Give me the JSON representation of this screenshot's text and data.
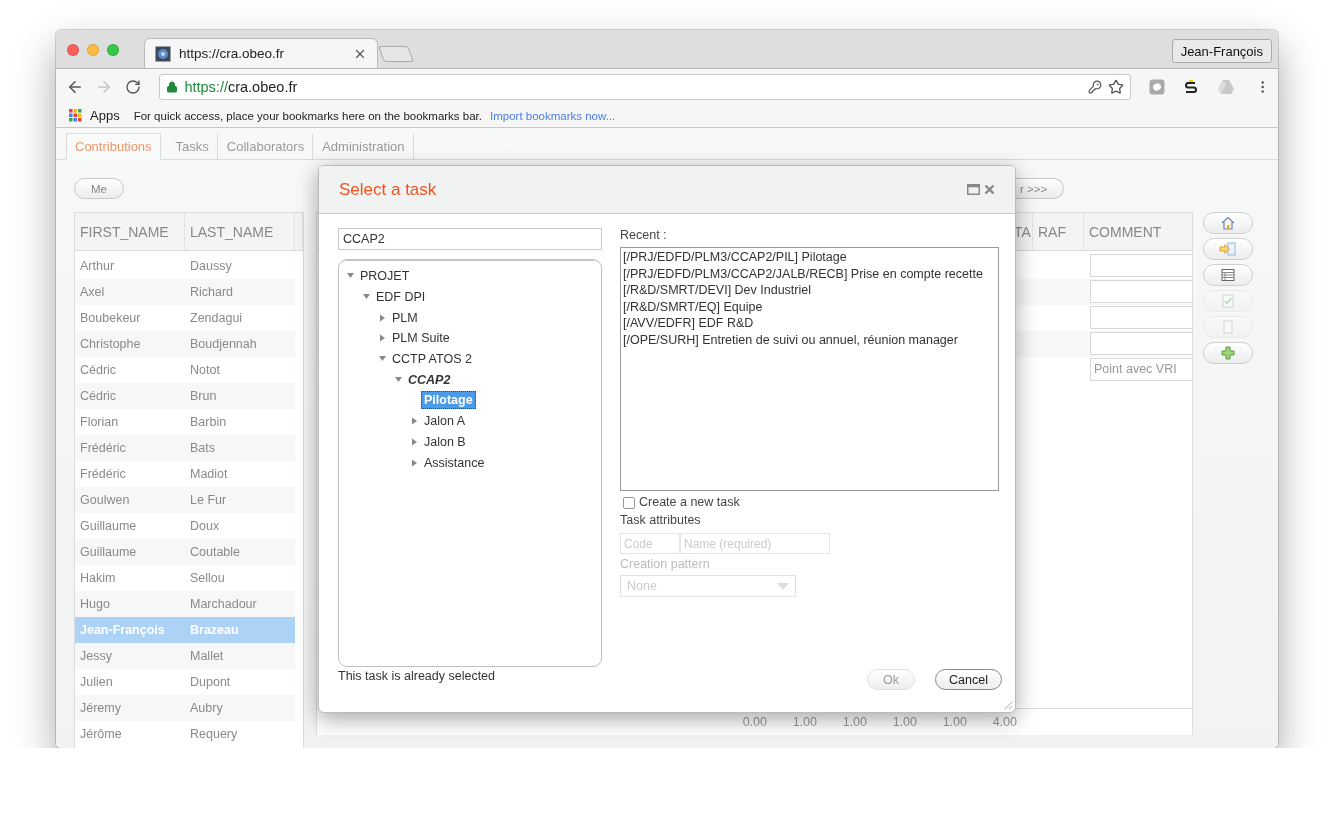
{
  "browser": {
    "tab_title": "https://cra.obeo.fr",
    "profile": "Jean-François",
    "url_scheme": "https://",
    "url_host": "cra.obeo.fr",
    "apps": "Apps",
    "bookmarks_hint": "For quick access, place your bookmarks here on the bookmarks bar.",
    "bookmarks_link": "Import bookmarks now..."
  },
  "app_tabs": [
    {
      "label": "Contributions",
      "selected": true
    },
    {
      "label": "Tasks",
      "selected": false
    },
    {
      "label": "Collaborators",
      "selected": false
    },
    {
      "label": "Administration",
      "selected": false
    }
  ],
  "me_button": "Me",
  "people_table": {
    "columns": [
      "FIRST_NAME",
      "LAST_NAME"
    ],
    "rows": [
      {
        "first": "Arthur",
        "last": "Daussy",
        "selected": false
      },
      {
        "first": "Axel",
        "last": "Richard",
        "selected": false
      },
      {
        "first": "Boubekeur",
        "last": "Zendagui",
        "selected": false
      },
      {
        "first": "Christophe",
        "last": "Boudjennah",
        "selected": false
      },
      {
        "first": "Cédric",
        "last": "Notot",
        "selected": false
      },
      {
        "first": "Cédric",
        "last": "Brun",
        "selected": false
      },
      {
        "first": "Florian",
        "last": "Barbin",
        "selected": false
      },
      {
        "first": "Frédéric",
        "last": "Bats",
        "selected": false
      },
      {
        "first": "Frédéric",
        "last": "Madiot",
        "selected": false
      },
      {
        "first": "Goulwen",
        "last": "Le Fur",
        "selected": false
      },
      {
        "first": "Guillaume",
        "last": "Doux",
        "selected": false
      },
      {
        "first": "Guillaume",
        "last": "Coutable",
        "selected": false
      },
      {
        "first": "Hakim",
        "last": "Sellou",
        "selected": false
      },
      {
        "first": "Hugo",
        "last": "Marchadour",
        "selected": false
      },
      {
        "first": "Jean-François",
        "last": "Brazeau",
        "selected": true
      },
      {
        "first": "Jessy",
        "last": "Mallet",
        "selected": false
      },
      {
        "first": "Julien",
        "last": "Dupont",
        "selected": false
      },
      {
        "first": "Jéremy",
        "last": "Aubry",
        "selected": false
      },
      {
        "first": "Jérôme",
        "last": "Requery",
        "selected": false
      }
    ]
  },
  "grid": {
    "nav_button": "r >>>",
    "columns": [
      "TA",
      "RAF",
      "COMMENT"
    ],
    "rows": [
      {
        "kind": "empty"
      },
      {
        "kind": "empty"
      },
      {
        "kind": "empty"
      },
      {
        "kind": "empty"
      },
      {
        "kind": "text",
        "comment": "Point avec VRI"
      }
    ],
    "totals": [
      "0.00",
      "1.00",
      "1.00",
      "1.00",
      "1.00",
      "4.00"
    ]
  },
  "side_buttons": [
    {
      "disabled": false
    },
    {
      "disabled": false
    },
    {
      "disabled": false
    },
    {
      "disabled": true
    },
    {
      "disabled": true
    },
    {
      "disabled": false
    }
  ],
  "dialog": {
    "title": "Select a task",
    "search": {
      "value": "CCAP2"
    },
    "tree": [
      {
        "label": "PROJET",
        "expanded": true,
        "selected": false,
        "match": false,
        "children": [
          {
            "label": "EDF DPI",
            "expanded": true,
            "selected": false,
            "match": false,
            "children": [
              {
                "label": "PLM",
                "expanded": false,
                "selected": false,
                "match": false
              },
              {
                "label": "PLM Suite",
                "expanded": false,
                "selected": false,
                "match": false
              },
              {
                "label": "CCTP ATOS 2",
                "expanded": true,
                "selected": false,
                "match": false,
                "children": [
                  {
                    "label": "CCAP2",
                    "expanded": true,
                    "selected": false,
                    "match": true,
                    "children": [
                      {
                        "label": "Pilotage",
                        "selected": true,
                        "match": false
                      },
                      {
                        "label": "Jalon A",
                        "expanded": false,
                        "selected": false,
                        "match": false
                      },
                      {
                        "label": "Jalon B",
                        "expanded": false,
                        "selected": false,
                        "match": false
                      },
                      {
                        "label": "Assistance",
                        "expanded": false,
                        "selected": false,
                        "match": false
                      }
                    ]
                  }
                ]
              }
            ]
          }
        ]
      }
    ],
    "status": "This task is already selected",
    "recent_label": "Recent :",
    "recent": [
      "[/PRJ/EDFD/PLM3/CCAP2/PIL] Pilotage",
      "[/PRJ/EDFD/PLM3/CCAP2/JALB/RECB] Prise en compte recette",
      "[/R&D/SMRT/DEVI] Dev Industriel",
      "[/R&D/SMRT/EQ] Equipe",
      "[/AVV/EDFR] EDF R&D",
      "[/OPE/SURH] Entretien de suivi ou annuel, réunion manager"
    ],
    "create_new_task": {
      "label": "Create a new task",
      "checked": false
    },
    "task_attributes_label": "Task attributes",
    "code": {
      "placeholder": "Code"
    },
    "name": {
      "placeholder": "Name (required)"
    },
    "creation_pattern": {
      "label": "Creation pattern",
      "value": "None"
    },
    "buttons": [
      {
        "label": "Ok",
        "disabled": true
      },
      {
        "label": "Cancel",
        "disabled": false
      }
    ]
  }
}
